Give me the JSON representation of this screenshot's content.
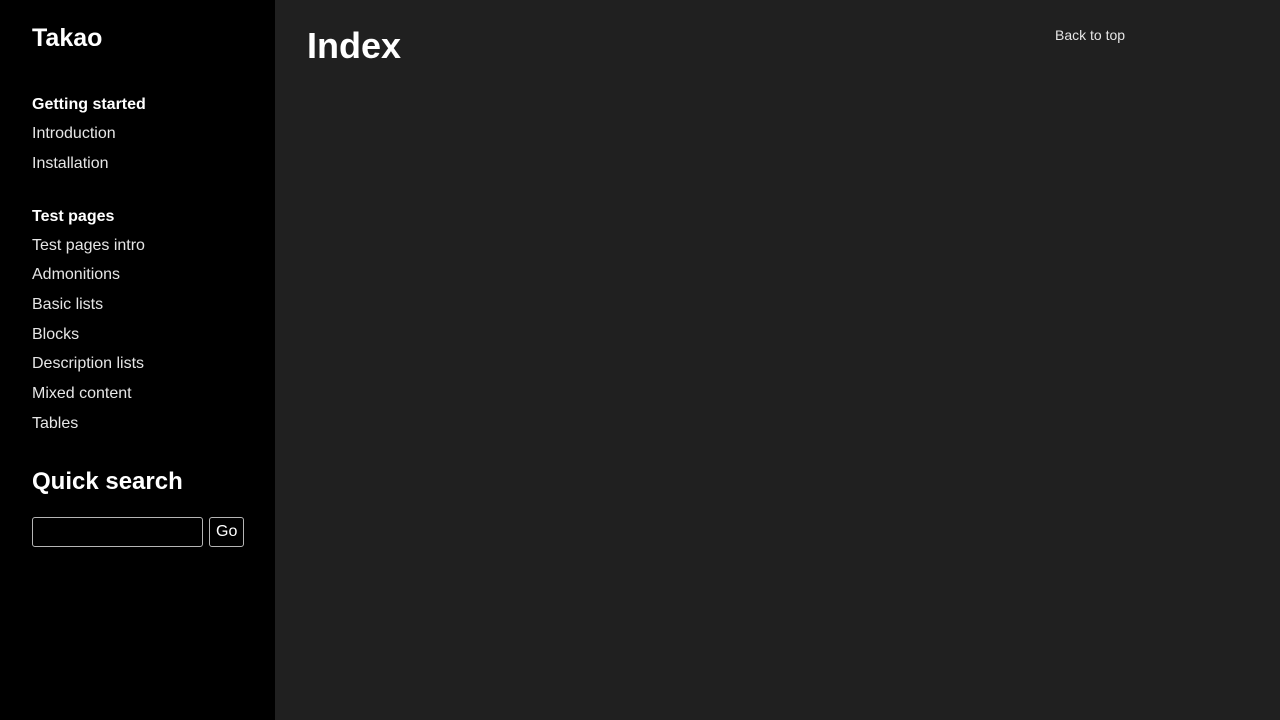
{
  "brand": "Takao",
  "sidebar": {
    "sections": [
      {
        "heading": "Getting started",
        "items": [
          "Introduction",
          "Installation"
        ]
      },
      {
        "heading": "Test pages",
        "items": [
          "Test pages intro",
          "Admonitions",
          "Basic lists",
          "Blocks",
          "Description lists",
          "Mixed content",
          "Tables"
        ]
      }
    ],
    "search": {
      "title": "Quick search",
      "input_value": "",
      "button_label": "Go"
    }
  },
  "main": {
    "title": "Index",
    "back_to_top": "Back to top"
  },
  "colors": {
    "sidebar_bg": "#000000",
    "main_bg": "#202020",
    "text": "#ffffff"
  }
}
